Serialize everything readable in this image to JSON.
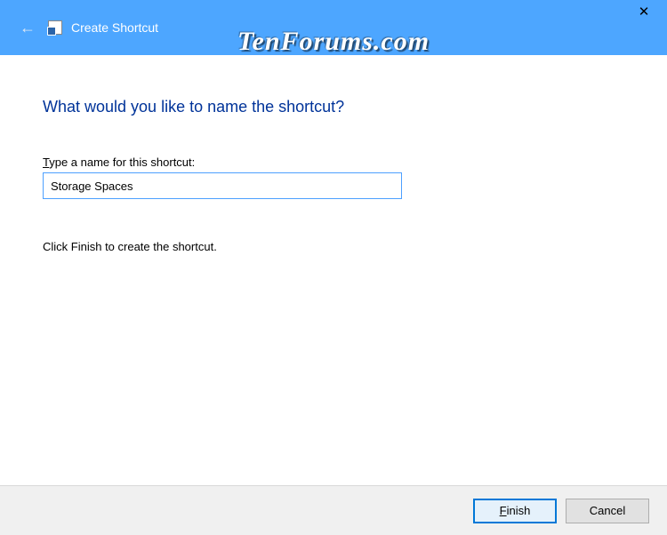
{
  "titlebar": {
    "title": "Create Shortcut"
  },
  "watermark": "TenForums.com",
  "heading": "What would you like to name the shortcut?",
  "field": {
    "label_pre": "T",
    "label_post": "ype a name for this shortcut:",
    "value": "Storage Spaces"
  },
  "instruction": "Click Finish to create the shortcut.",
  "footer": {
    "finish_pre": "",
    "finish_btn": "Finish",
    "cancel_btn": "Cancel"
  }
}
